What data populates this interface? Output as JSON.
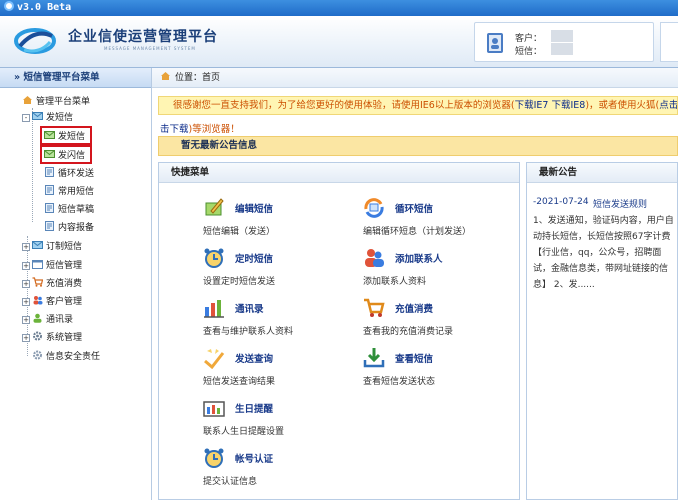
{
  "window": {
    "title": "v3.0 Beta"
  },
  "header": {
    "brand_title": "企业信使运营管理平台",
    "brand_sub": "MESSAGE MANAGEMENT SYSTEM",
    "customer_label": "客户：",
    "sms_label": "短信："
  },
  "sidebar": {
    "title": "» 短信管理平台菜单",
    "root": "管理平台菜单",
    "group_send": "发短信",
    "send_items": [
      "发短信",
      "发闪信",
      "循环发送",
      "常用短信",
      "短信草稿",
      "内容报备"
    ],
    "groups": [
      "订制短信",
      "短信管理",
      "充值消费",
      "客户管理",
      "通讯录",
      "系统管理",
      "信息安全责任"
    ]
  },
  "breadcrumb": {
    "text": "位置：首页"
  },
  "notice": {
    "line1": "很感谢您一直支持我们，为了给您更好的使用体验，请使用IE6以上版本的浏览器(",
    "link_ie7": "下载IE7",
    "link_ie8": "下载IE8",
    "mid": ")，或者使用火狐(",
    "link_ff": "点击下载",
    "line2_link": "击下载",
    "line2_rest": ")等浏览器！"
  },
  "announcement": {
    "text": "暂无最新公告信息"
  },
  "quick_menu": {
    "title": "快捷菜单",
    "items": [
      {
        "label": "编辑短信",
        "desc": "短信编辑（发送）"
      },
      {
        "label": "循环短信",
        "desc": "编辑循环短息（计划发送）"
      },
      {
        "label": "定时短信",
        "desc": "设置定时短信发送"
      },
      {
        "label": "添加联系人",
        "desc": "添加联系人资料"
      },
      {
        "label": "通讯录",
        "desc": "查看与维护联系人资料"
      },
      {
        "label": "充值消费",
        "desc": "查看我的充值消费记录"
      },
      {
        "label": "发送查询",
        "desc": "短信发送查询结果"
      },
      {
        "label": "查看短信",
        "desc": "查看短信发送状态"
      },
      {
        "label": "生日提醒",
        "desc": "联系人生日提醒设置"
      },
      {
        "label": "帐号认证",
        "desc": "提交认证信息"
      }
    ]
  },
  "latest": {
    "title": "最新公告",
    "date": "-2021-07-24",
    "news_title": "短信发送规则",
    "body": "1、发送通知，验证码内容，用户自动持长短信，长短信按照67字计费【行业信，qq，公众号，招聘面试，金融信息类，带网址链接的信息】 2、发......"
  },
  "colors": {
    "accent": "#1a3b8a",
    "notice_text": "#cc4f00",
    "highlight": "#d3151d"
  }
}
